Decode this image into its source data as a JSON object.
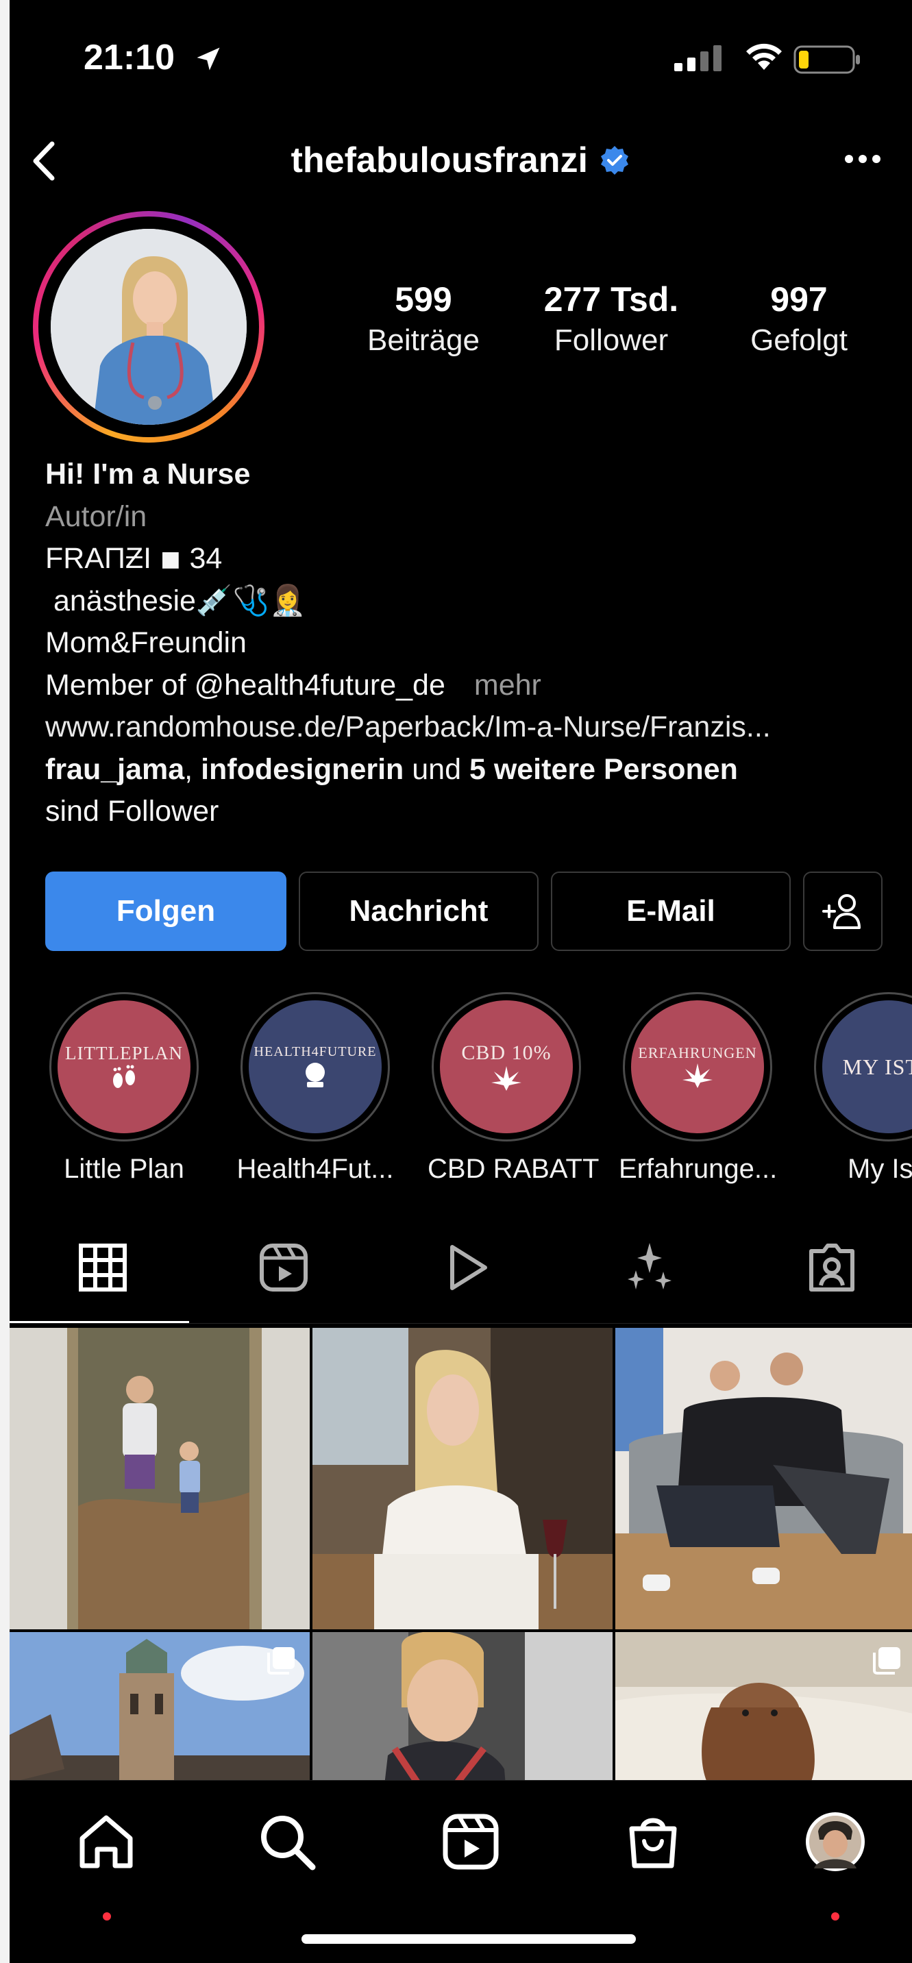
{
  "status_bar": {
    "time": "21:10",
    "icons": [
      "location-arrow-icon",
      "cellular-signal-icon",
      "wifi-icon",
      "battery-low-icon"
    ]
  },
  "header": {
    "username": "thefabulousfranzi",
    "verified": true,
    "back_icon": "chevron-left-icon",
    "more_icon": "ellipsis-icon"
  },
  "stats": [
    {
      "value": "599",
      "label": "Beiträge"
    },
    {
      "value": "277 Tsd.",
      "label": "Follower"
    },
    {
      "value": "997",
      "label": "Gefolgt"
    }
  ],
  "bio": {
    "name": "Hi! I'm a Nurse",
    "category": "Autor/in",
    "line1": "FRAПƵI ◾ 34",
    "line2": " anästhesie💉🩺👩‍⚕️",
    "line3": "Mom&Freundin",
    "line4": "Member of @health4future_de",
    "more": "mehr",
    "website": "www.randomhouse.de/Paperback/Im-a-Nurse/Franzis...",
    "followers_user1": "frau_jama",
    "followers_sep": ", ",
    "followers_user2": "infodesignerin",
    "followers_and": " und ",
    "followers_others": "5 weitere Personen",
    "followers_suffix": "sind Follower"
  },
  "buttons": {
    "follow": "Folgen",
    "message": "Nachricht",
    "email": "E-Mail",
    "add_user_icon": "add-person-icon"
  },
  "highlights": [
    {
      "label": "Little Plan",
      "cover_text": "LITTLEPLAN",
      "color": "#b04a5a"
    },
    {
      "label": "Health4Fut...",
      "cover_text": "HEALTH4FUTURE",
      "color": "#3b4670"
    },
    {
      "label": "CBD RABATT",
      "cover_text": "CBD 10%",
      "color": "#b04a5a"
    },
    {
      "label": "Erfahrunge...",
      "cover_text": "ERFAHRUNGEN",
      "color": "#b04a5a"
    },
    {
      "label": "My Istr",
      "cover_text": "MY ISTR",
      "color": "#3b4670"
    }
  ],
  "tabs": [
    "grid-icon",
    "reels-icon",
    "play-icon",
    "sparkles-icon",
    "tagged-person-icon"
  ],
  "grid_posts": [
    {
      "name": "post-1"
    },
    {
      "name": "post-2"
    },
    {
      "name": "post-3"
    },
    {
      "name": "post-4",
      "multiple": true
    },
    {
      "name": "post-5"
    },
    {
      "name": "post-6",
      "multiple": true
    }
  ],
  "bottom_nav": [
    "home-icon",
    "search-icon",
    "reels-icon",
    "shop-icon",
    "profile-avatar"
  ],
  "colors": {
    "accent": "#3b88eb",
    "notification_dot": "#ff3040",
    "background": "#000000"
  }
}
